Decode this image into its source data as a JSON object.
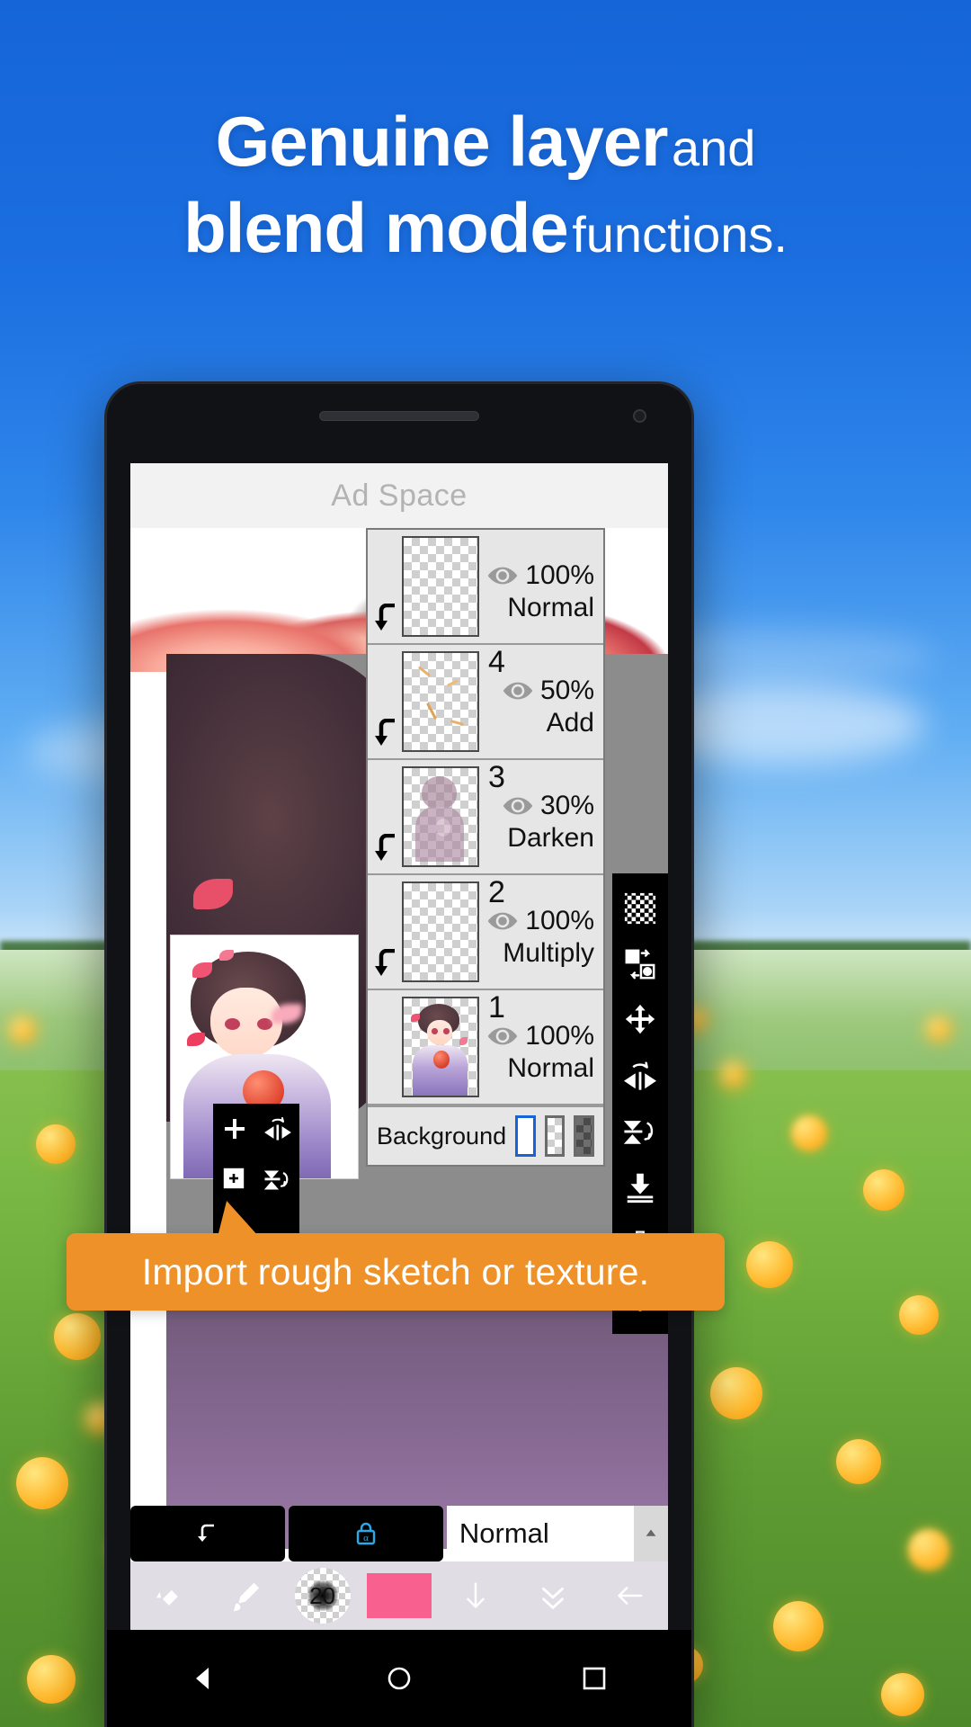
{
  "headline": {
    "line1_strong": "Genuine layer",
    "line1_light": "and",
    "line2_strong": "blend mode",
    "line2_light": "functions."
  },
  "callout": {
    "text": "Import rough sketch or texture."
  },
  "phone": {
    "ad_space": {
      "label": "Ad Space"
    },
    "navbar": {
      "back": "back-icon",
      "home": "home-icon",
      "recents": "recents-icon"
    }
  },
  "layers_panel": {
    "rows": [
      {
        "num": "",
        "opacity": "100%",
        "blend": "Normal",
        "thumb": "empty",
        "clipped": true,
        "eye": "visible"
      },
      {
        "num": "4",
        "opacity": "50%",
        "blend": "Add",
        "thumb": "sparkle",
        "clipped": true,
        "eye": "visible"
      },
      {
        "num": "3",
        "opacity": "30%",
        "blend": "Darken",
        "thumb": "figure",
        "clipped": true,
        "eye": "visible"
      },
      {
        "num": "2",
        "opacity": "100%",
        "blend": "Multiply",
        "thumb": "empty",
        "clipped": true,
        "eye": "visible"
      },
      {
        "num": "1",
        "opacity": "100%",
        "blend": "Normal",
        "thumb": "artwork",
        "clipped": false,
        "eye": "visible"
      }
    ],
    "background": {
      "label": "Background",
      "swatches": [
        "white",
        "checker",
        "dark-checker"
      ],
      "selected": "white"
    }
  },
  "right_toolbar": {
    "buttons": [
      {
        "name": "transparency-icon"
      },
      {
        "name": "swap-layers-icon"
      },
      {
        "name": "move-layer-icon"
      },
      {
        "name": "flip-horizontal-icon"
      },
      {
        "name": "flip-vertical-icon"
      },
      {
        "name": "merge-down-icon"
      },
      {
        "name": "delete-layer-icon"
      },
      {
        "name": "more-options-icon"
      }
    ]
  },
  "left_toolbox": {
    "buttons": [
      {
        "name": "add-layer-icon"
      },
      {
        "name": "rotate-icon"
      },
      {
        "name": "duplicate-layer-icon"
      },
      {
        "name": "flip-icon"
      },
      {
        "name": "camera-import-icon"
      }
    ]
  },
  "layer_bottom_bar": {
    "clip-button": "clipping-mask-icon",
    "alpha-lock-button": "alpha-lock-icon",
    "alpha_symbol": "α",
    "blend_mode": {
      "value": "Normal",
      "spinner": "spinner-up-icon"
    }
  },
  "tool_strip": {
    "undo": "undo-eraser-icon",
    "brush": "brush-icon",
    "brush_size": "20",
    "color": "#f8608f",
    "down_arrow": "arrow-down-icon",
    "double_down": "double-arrow-down-icon",
    "back_arrow": "arrow-left-icon"
  },
  "colors": {
    "sky": "#1565d8",
    "callout_orange": "#ee9128",
    "accent_blue": "#1565d8",
    "panel_grey": "#e6e6e6",
    "panel_border": "#9a9a9a",
    "pink_swatch": "#f8608f",
    "alpha_cyan": "#2aa9e8"
  }
}
